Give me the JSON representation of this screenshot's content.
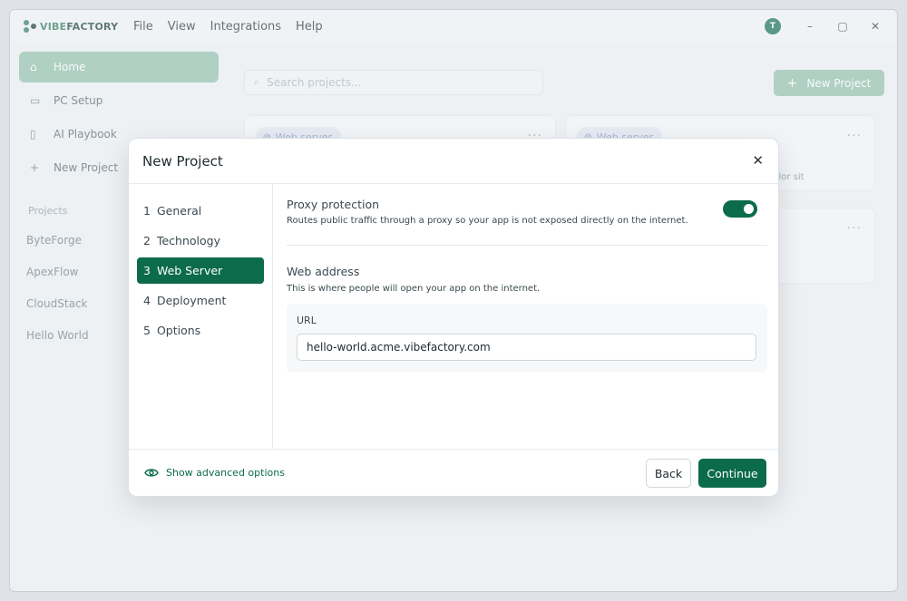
{
  "titlebar": {
    "logo": {
      "brand_prefix": "VIBE",
      "brand_suffix": "FACTORY"
    },
    "menu": [
      "File",
      "View",
      "Integrations",
      "Help"
    ],
    "avatar_initial": "T",
    "controls": {
      "minimize": "–",
      "maximize": "▢",
      "close": "✕"
    }
  },
  "sidebar": {
    "items": [
      {
        "label": "Home",
        "icon": "home-icon"
      },
      {
        "label": "PC Setup",
        "icon": "monitor-icon"
      },
      {
        "label": "AI Playbook",
        "icon": "book-icon"
      },
      {
        "label": "New Project",
        "icon": "plus-icon"
      }
    ],
    "projects_heading": "Projects",
    "projects": [
      "ByteForge",
      "ApexFlow",
      "CloudStack",
      "Hello World"
    ]
  },
  "main": {
    "search_placeholder": "Search projects...",
    "new_project_label": "New Project",
    "cards": [
      {
        "chip": "Web server",
        "text": ""
      },
      {
        "chip": "Web server",
        "text": "dolor sit"
      }
    ]
  },
  "modal": {
    "title": "New Project",
    "steps": [
      {
        "num": "1",
        "label": "General"
      },
      {
        "num": "2",
        "label": "Technology"
      },
      {
        "num": "3",
        "label": "Web Server"
      },
      {
        "num": "4",
        "label": "Deployment"
      },
      {
        "num": "5",
        "label": "Options"
      }
    ],
    "active_step": 3,
    "proxy": {
      "title": "Proxy protection",
      "description": "Routes public traffic through a proxy so your app is not exposed directly on the internet.",
      "enabled": true
    },
    "web_address": {
      "title": "Web address",
      "description": "This is where people will open your app on the internet.",
      "url_label": "URL",
      "url_value": "hello-world.acme.vibefactory.com"
    },
    "footer": {
      "advanced_label": "Show advanced options",
      "back_label": "Back",
      "continue_label": "Continue"
    }
  },
  "colors": {
    "accent": "#0c6b4b",
    "accent_dimmed": "#8fbfa8",
    "chip_text": "#7f97c4"
  }
}
